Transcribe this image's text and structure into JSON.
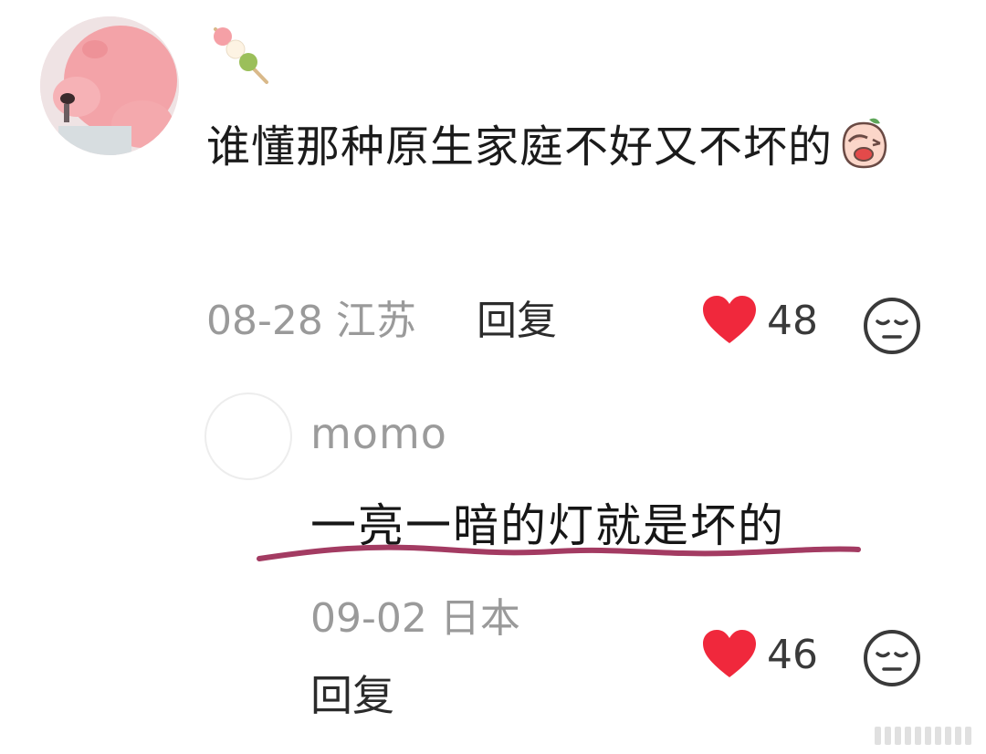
{
  "comment": {
    "text": "谁懂那种原生家庭不好又不坏的",
    "date": "08-28",
    "location": "江苏",
    "reply_label": "回复",
    "likes": "48",
    "badge_icon": "skewer-dango-icon",
    "emoji_icon": "facepalm-crying-emoji-icon"
  },
  "reply": {
    "username": "momo",
    "text": "一亮一暗的灯就是坏的",
    "date": "09-02",
    "location": "日本",
    "reply_label": "回复",
    "likes": "46"
  },
  "colors": {
    "heart": "#f0283c",
    "underline": "#a33b62"
  }
}
